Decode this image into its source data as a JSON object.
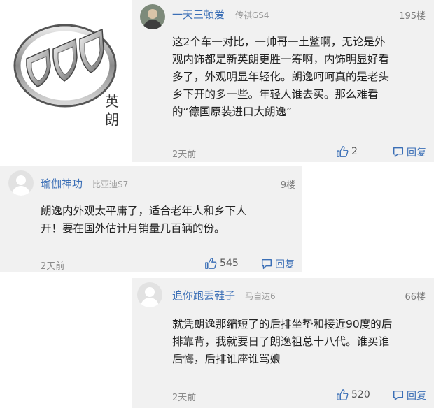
{
  "brand": {
    "logo_name": "buick-shield-logo",
    "name_chars": [
      "英",
      "朗"
    ]
  },
  "comments": [
    {
      "username": "一天三顿爱",
      "car": "传祺GS4",
      "floor": "195楼",
      "lines": [
        "这2个车一对比，一帅哥一土鳖啊，无论是外",
        "观内饰都是新英朗更胜一筹啊，内饰明显好看",
        "多了，外观明显年轻化。朗逸呵呵真的是老头",
        "乡下开的多一些。年轻人谁去买。那么难看",
        "的“德国原装进口大朗逸”"
      ],
      "time": "2天前",
      "likes": "2",
      "reply_label": "回复"
    },
    {
      "username": "瑜伽神功",
      "car": "比亚迪S7",
      "floor": "9楼",
      "lines": [
        "朗逸内外观太平庸了，适合老年人和乡下人",
        "开！要在国外估计月销量几百辆的份。"
      ],
      "time": "2天前",
      "likes": "545",
      "reply_label": "回复"
    },
    {
      "username": "追你跑丢鞋子",
      "car": "马自达6",
      "floor": "66楼",
      "lines": [
        "就凭朗逸那缩短了的后排坐垫和接近90度的后",
        "排靠背，我就要日了朗逸祖总十八代。谁买谁",
        "后悔，后排谁座谁骂娘"
      ],
      "time": "2天前",
      "likes": "520",
      "reply_label": "回复"
    }
  ]
}
